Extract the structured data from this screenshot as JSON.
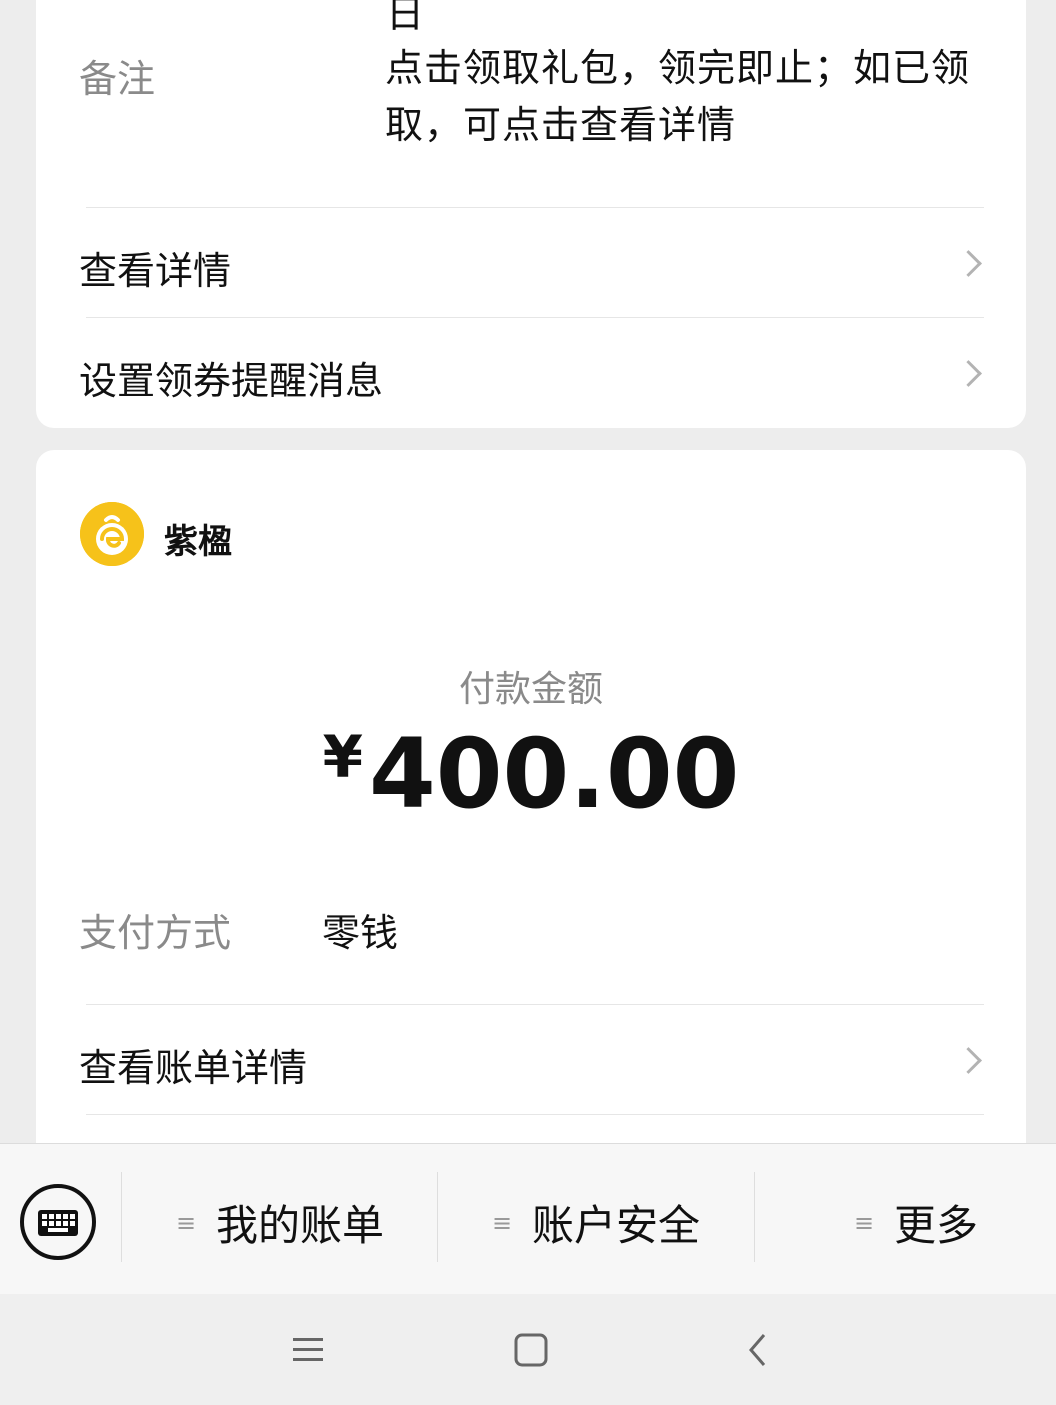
{
  "top_card": {
    "cut_off_char": "日",
    "remark_label": "备注",
    "remark_value": "点击领取礼包，领完即止；如已领取，可点击查看详情",
    "view_details": "查看详情",
    "coupon_reminder": "设置领券提醒消息"
  },
  "payment_card": {
    "merchant_name": "紫楹",
    "amount_label": "付款金额",
    "currency_symbol": "¥",
    "amount": "400.00",
    "method_label": "支付方式",
    "method_value": "零钱",
    "bill_details": "查看账单详情"
  },
  "bottom_menu": {
    "items": [
      {
        "label": "我的账单"
      },
      {
        "label": "账户安全"
      },
      {
        "label": "更多"
      }
    ],
    "menu_icon": "≡"
  },
  "colors": {
    "background": "#ededed",
    "logo_yellow": "#f6c21a"
  },
  "icons": [
    "chevron-right-icon",
    "keyboard-icon",
    "menu-lines-icon",
    "nav-menu-icon",
    "nav-home-icon",
    "nav-back-icon"
  ]
}
